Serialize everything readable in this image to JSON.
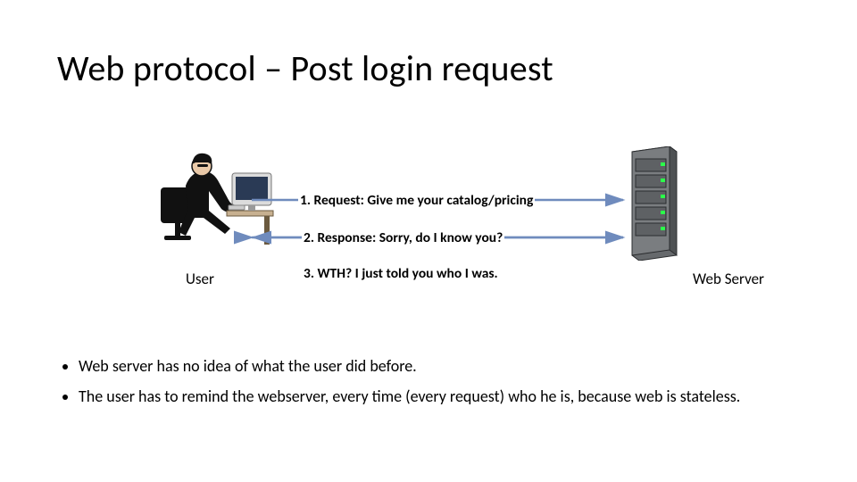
{
  "title": "Web protocol – Post login request",
  "labels": {
    "user": "User",
    "server": "Web Server"
  },
  "messages": {
    "m1": "1. Request: Give me your catalog/pricing",
    "m2": "2. Response: Sorry, do I know you?",
    "m3": "3. WTH?  I just told you who I was."
  },
  "bullets": {
    "b1": "Web server has no idea of what the user did before.",
    "b2": "The user has to remind the webserver, every time (every request) who he is, because web is stateless."
  }
}
